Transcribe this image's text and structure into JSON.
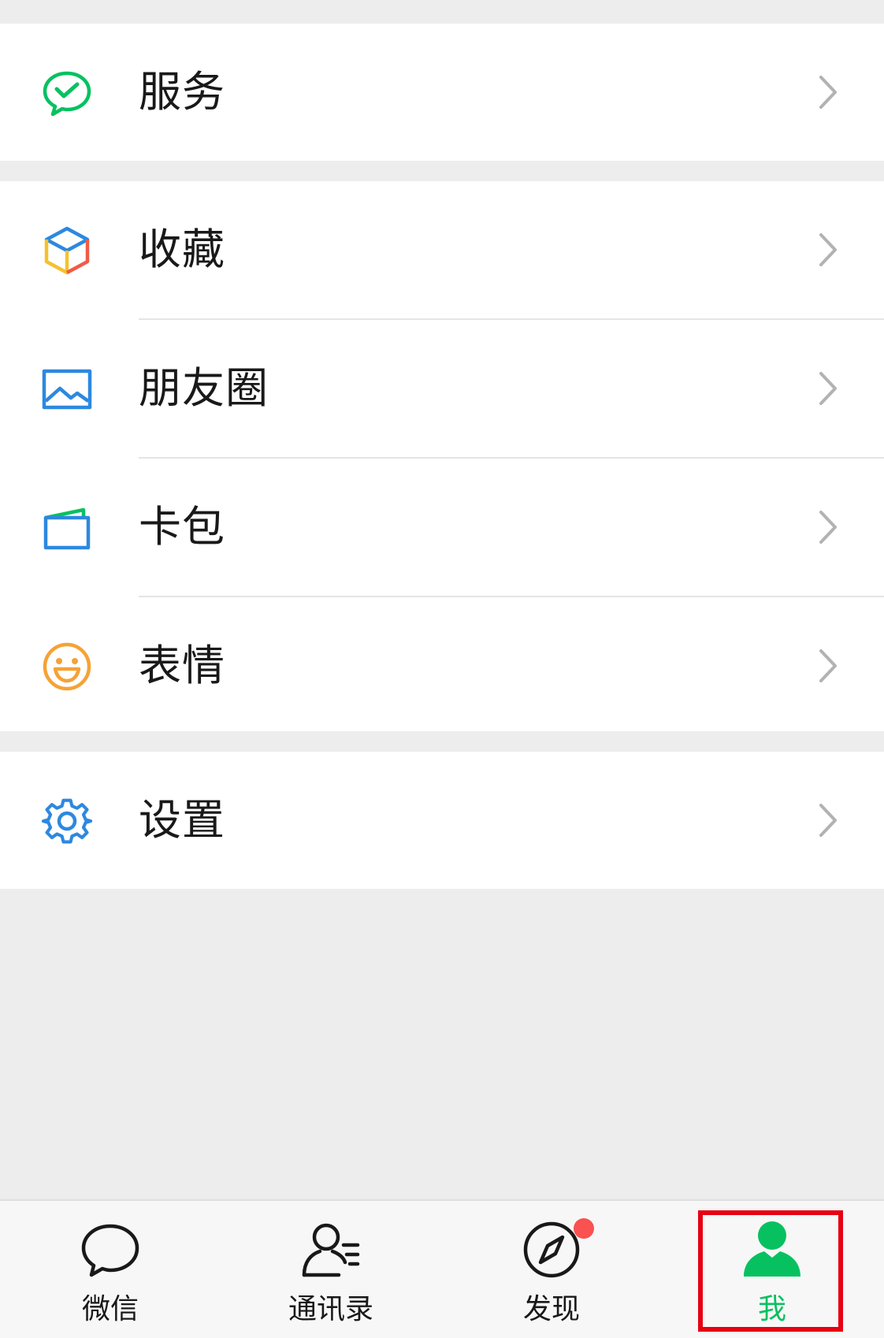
{
  "colors": {
    "background": "#ededed",
    "cell": "#ffffff",
    "accent_green": "#07c160",
    "blue": "#2d88e0",
    "orange": "#f5a236",
    "red_dot": "#fa5151",
    "highlight": "#e60012"
  },
  "menu": {
    "services": {
      "label": "服务",
      "icon": "wechat-pay-icon"
    },
    "favorites": {
      "label": "收藏",
      "icon": "cube-icon"
    },
    "moments": {
      "label": "朋友圈",
      "icon": "landscape-picture-icon"
    },
    "cards": {
      "label": "卡包",
      "icon": "wallet-card-icon"
    },
    "stickers": {
      "label": "表情",
      "icon": "smiley-icon"
    },
    "settings": {
      "label": "设置",
      "icon": "gear-icon"
    }
  },
  "tabbar": {
    "chats": {
      "label": "微信",
      "icon": "chat-bubble-icon"
    },
    "contacts": {
      "label": "通讯录",
      "icon": "contacts-icon"
    },
    "discover": {
      "label": "发现",
      "icon": "compass-icon",
      "has_badge": true
    },
    "me": {
      "label": "我",
      "icon": "person-icon",
      "active": true
    }
  }
}
